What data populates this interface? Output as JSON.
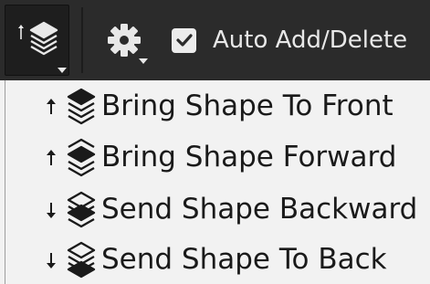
{
  "toolbar": {
    "arrange_button": {
      "icon": "layers-icon"
    },
    "settings_button": {
      "icon": "gear-icon"
    },
    "auto_add_delete": {
      "label": "Auto Add/Delete",
      "checked": true
    }
  },
  "menu": {
    "items": [
      {
        "label": "Bring Shape To Front",
        "icon": "bring-to-front-icon",
        "direction": "up"
      },
      {
        "label": "Bring Shape Forward",
        "icon": "bring-forward-icon",
        "direction": "up"
      },
      {
        "label": "Send Shape Backward",
        "icon": "send-backward-icon",
        "direction": "down"
      },
      {
        "label": "Send Shape To Back",
        "icon": "send-to-back-icon",
        "direction": "down"
      }
    ]
  },
  "colors": {
    "toolbar_bg": "#2b2b2b",
    "toolbar_fg": "#e8e8e8",
    "menu_bg": "#f2f2f2",
    "menu_fg": "#1a1a1a"
  }
}
